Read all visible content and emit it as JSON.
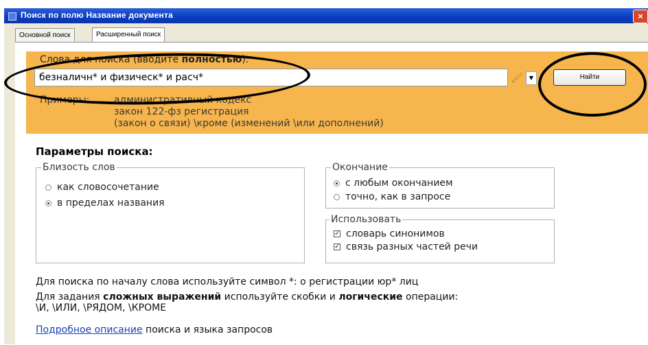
{
  "window": {
    "title": "Поиск по полю Название документа",
    "close_glyph": "×"
  },
  "tabs": [
    {
      "label": "Основной поиск"
    },
    {
      "label": "Расширенный поиск",
      "active": true
    }
  ],
  "search": {
    "label_prefix": "Слова для поиска (вводите ",
    "label_bold": "полностью",
    "label_suffix": "):",
    "value": "безналичн* и физическ* и расч*",
    "button_label": "Найти",
    "dropdown_glyph": "▼",
    "brush_glyph": "🖌"
  },
  "examples": {
    "label": "Примеры:",
    "items": [
      "административный кодекс",
      "закон 122-фз регистрация",
      "(закон о связи) \\кроме (изменений \\или дополнений)"
    ]
  },
  "params": {
    "title": "Параметры поиска:",
    "proximity": {
      "legend": "Близость слов",
      "options": [
        {
          "label": "как словосочетание",
          "selected": false
        },
        {
          "label": "в пределах названия",
          "selected": true
        }
      ]
    },
    "ending": {
      "legend": "Окончание",
      "options": [
        {
          "label": "с любым окончанием",
          "selected": true
        },
        {
          "label": "точно, как в запросе",
          "selected": false
        }
      ]
    },
    "use": {
      "legend": "Использовать",
      "options": [
        {
          "label": "словарь синонимов",
          "checked": true
        },
        {
          "label": "связь разных частей речи",
          "checked": true
        }
      ]
    }
  },
  "notes": {
    "prefix_tip": "Для поиска по началу слова используйте символ *: о регистрации юр* лиц",
    "complex_part1": "Для задания ",
    "complex_bold1": "сложных выражений",
    "complex_part2": " используйте скобки и ",
    "complex_bold2": "логические",
    "complex_part3": " операции:",
    "operators": "\\И, \\ИЛИ, \\РЯДОМ, \\КРОМЕ",
    "link_text": "Подробное описание",
    "link_suffix": " поиска и языка запросов"
  },
  "colors": {
    "panel_accent": "#f7b54d",
    "titlebar": "#0a3cc0",
    "link": "#1a3fb5"
  }
}
